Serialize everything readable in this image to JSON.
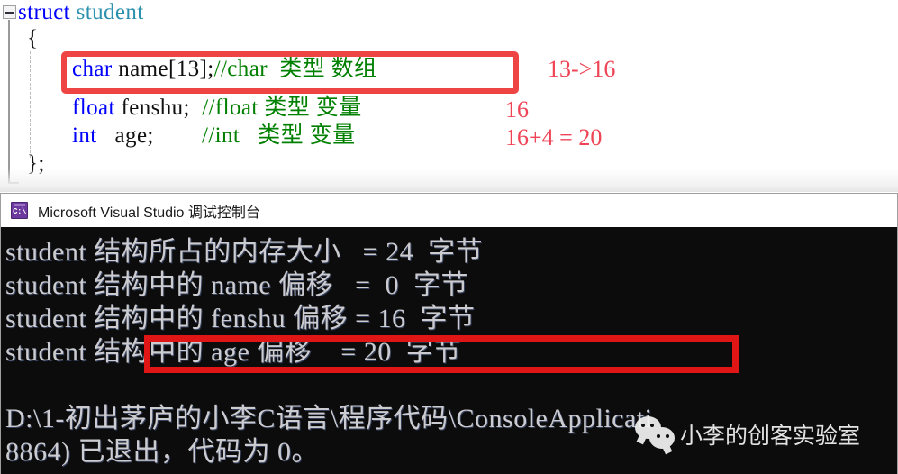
{
  "editor": {
    "fold_icon": "collapse-minus-icon",
    "lines": [
      {
        "id": "struct",
        "keyword": "struct",
        "name": "student"
      },
      {
        "id": "open",
        "text": "{"
      },
      {
        "id": "char",
        "keyword": "char",
        "decl": " name[13];",
        "comment": "//char  类型 数组"
      },
      {
        "id": "float",
        "keyword": "float",
        "decl": " fenshu;  ",
        "comment": "//float 类型 变量"
      },
      {
        "id": "int",
        "keyword": "int",
        "decl": "   age;        ",
        "comment": "//int   类型 变量"
      },
      {
        "id": "close",
        "text": "};"
      }
    ],
    "code_text": {
      "struct_keyword": "struct ",
      "struct_name": "student",
      "brace_open": "{",
      "char_keyword": "char",
      "char_decl": " name[13];",
      "char_comment": "//char  类型 数组",
      "float_keyword": "float",
      "float_decl": " fenshu;  ",
      "float_comment": "//float 类型 变量",
      "int_keyword": "int",
      "int_decl": "   age;        ",
      "int_comment": "//int   类型 变量",
      "brace_close": "};"
    },
    "annotations": [
      "13->16",
      "16",
      "16+4 = 20"
    ]
  },
  "console": {
    "title": "Microsoft Visual Studio 调试控制台",
    "icon_label": "C:\\",
    "icon_name": "console-app-icon",
    "output_lines": [
      "student 结构所占的内存大小   = 24  字节",
      "student 结构中的 name 偏移   =  0  字节",
      "student 结构中的 fenshu 偏移 = 16  字节",
      "student 结构中的 age 偏移    = 20  字节",
      "D:\\1-初出茅庐的小李C语言\\程序代码\\ConsoleApplicati",
      "8864) 已退出，代码为 0。"
    ]
  },
  "watermark": {
    "text": "小李的创客实验室",
    "logo_name": "wechat-logo-icon"
  },
  "colors": {
    "code_box_red": "#ef4444",
    "console_box_red": "#e01616",
    "annotation_red": "#ef4455",
    "keyword_blue": "#0000ff",
    "type_teal": "#2b91af",
    "comment_green": "#008000",
    "console_bg": "#0c0c0c",
    "console_fg": "#ccccd0"
  }
}
